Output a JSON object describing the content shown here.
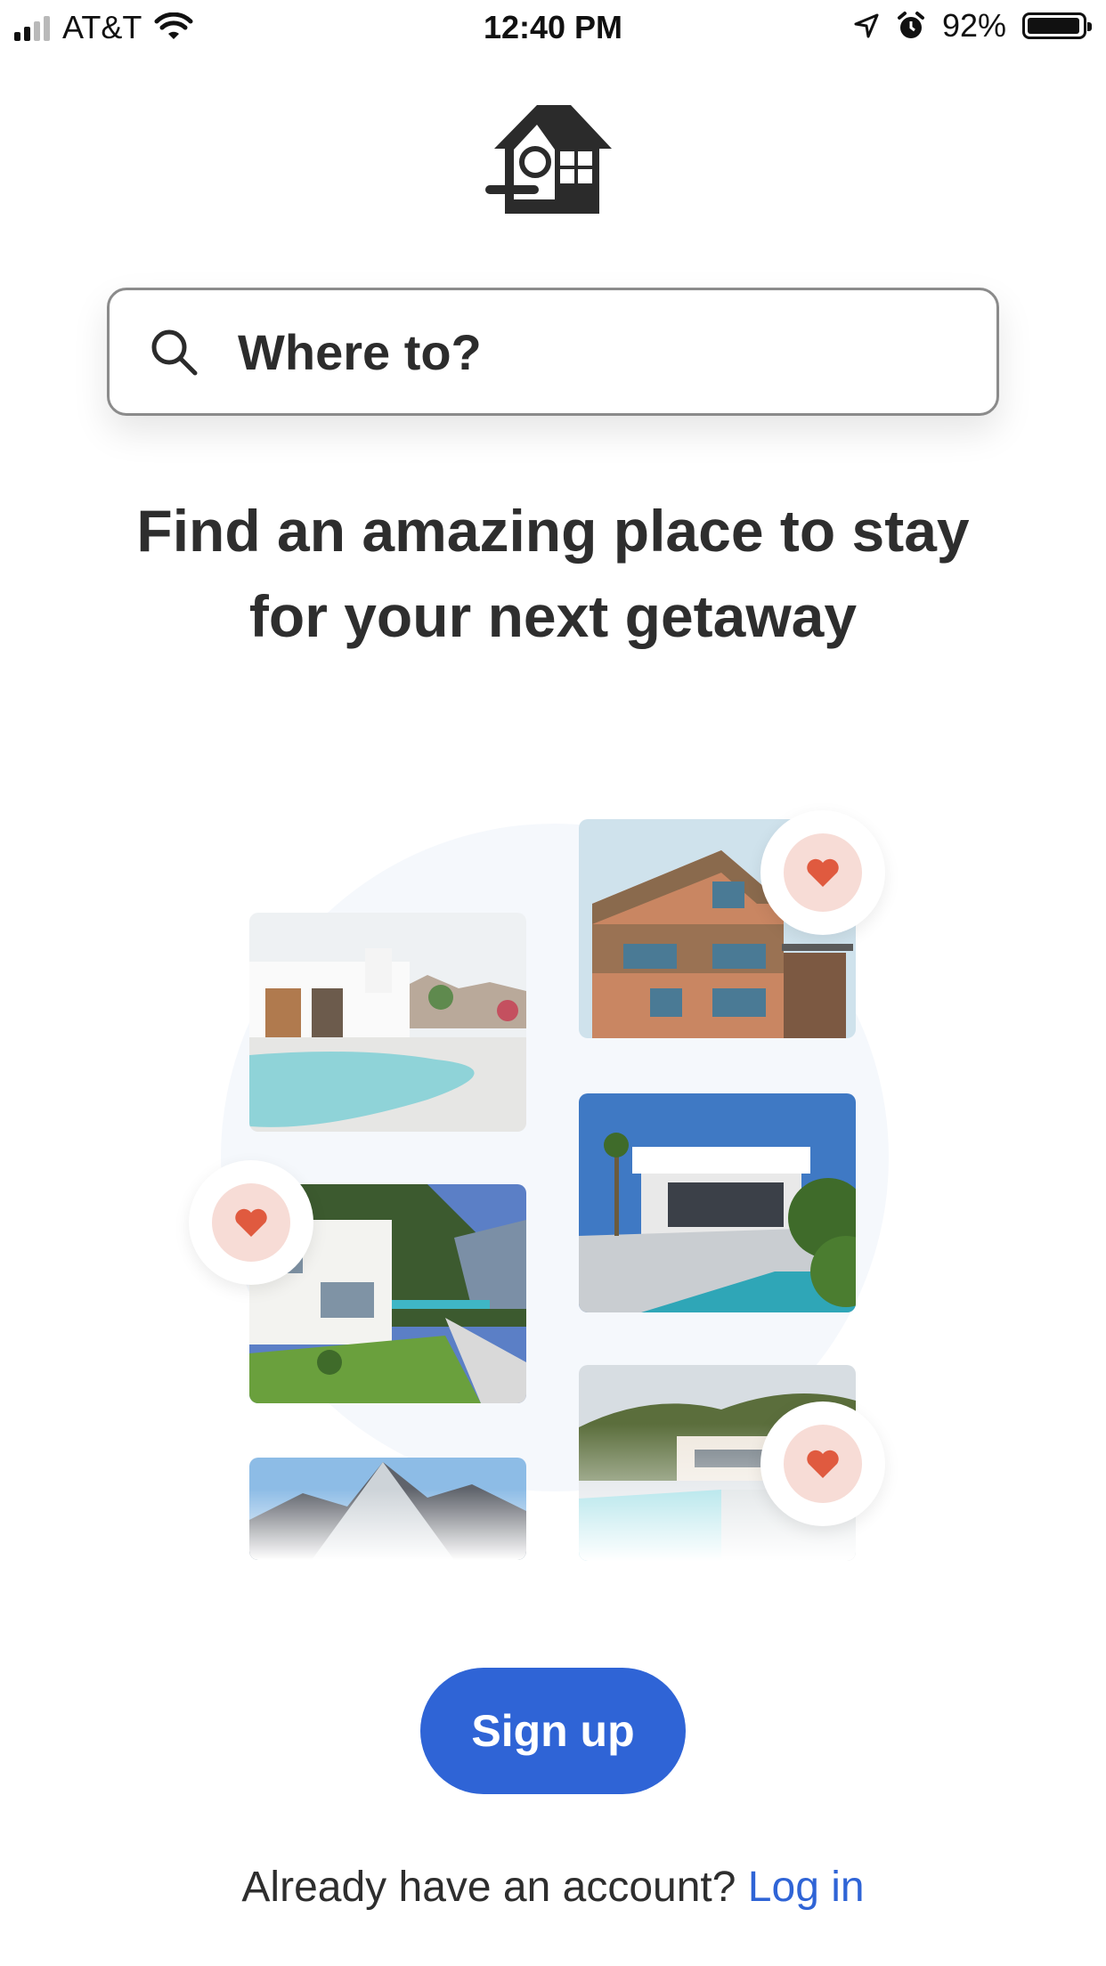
{
  "status_bar": {
    "carrier": "AT&T",
    "time": "12:40 PM",
    "battery": "92%",
    "icons": [
      "signal-icon",
      "wifi-icon",
      "location-arrow-icon",
      "alarm-icon",
      "battery-icon"
    ]
  },
  "logo": {
    "icon": "birdhouse-logo-icon"
  },
  "search": {
    "placeholder": "Where to?",
    "icon": "search-icon"
  },
  "headline": {
    "line1": "Find an amazing place to stay",
    "line2": "for your next getaway"
  },
  "gallery": {
    "tiles": [
      {
        "name": "pool-villa-photo"
      },
      {
        "name": "wooden-apartment-photo"
      },
      {
        "name": "hillside-villa-photo"
      },
      {
        "name": "modern-house-pool-photo"
      },
      {
        "name": "house-roof-photo"
      },
      {
        "name": "resort-villa-photo"
      }
    ],
    "heart_icon": "heart-icon",
    "colors": {
      "heart": "#e05a3f",
      "heart_bg": "#f7dcd6"
    }
  },
  "cta": {
    "signup_label": "Sign up",
    "login_prompt": "Already have an account?",
    "login_label": "Log in",
    "accent": "#2f64d6"
  }
}
